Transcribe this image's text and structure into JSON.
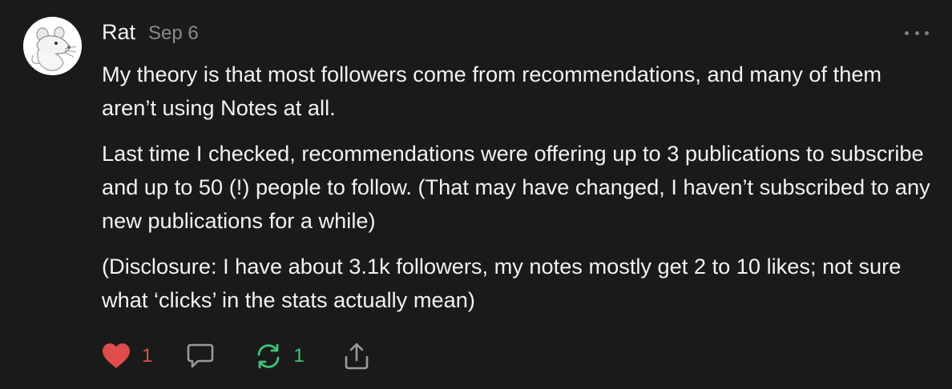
{
  "note": {
    "author": "Rat",
    "date": "Sep 6",
    "paragraphs": [
      "My theory is that most followers come from recommendations, and many of them aren’t using Notes at all.",
      "Last time I checked, recommendations were offering up to 3 publications to subscribe and up to 50 (!) people to follow. (That may have changed, I haven’t subscribed to any new publications for a while)",
      "(Disclosure: I have about 3.1k followers, my notes mostly get 2 to 10 likes; not sure what ‘clicks’ in the stats actually mean)"
    ],
    "actions": {
      "like_count": "1",
      "restack_count": "1"
    }
  },
  "icons": {
    "avatar": "rat-avatar-icon",
    "more": "more-dots-icon",
    "like": "heart-icon",
    "comment": "comment-bubble-icon",
    "restack": "restack-icon",
    "share": "share-icon"
  },
  "colors": {
    "background": "#1a1a1a",
    "like": "#e04b4b",
    "restack": "#3dc47a",
    "muted": "#8a8a8a"
  }
}
